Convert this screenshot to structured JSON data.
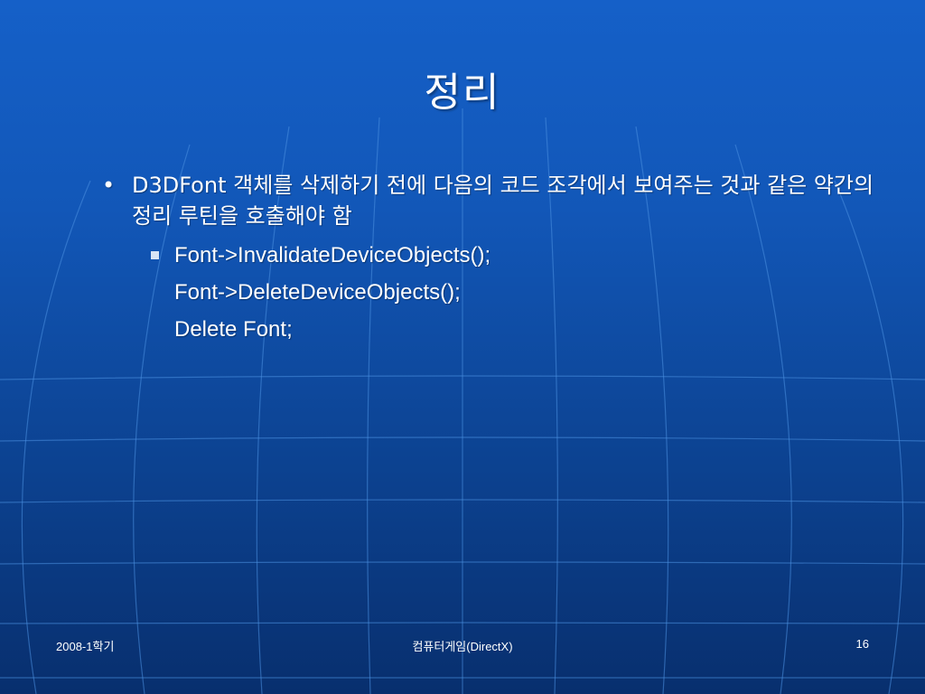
{
  "slide": {
    "title": "정리",
    "bullet": {
      "marker": "•",
      "text": "D3DFont 객체를 삭제하기 전에 다음의 코드 조각에서 보여주는 것과 같은 약간의 정리 루틴을 호출해야 함"
    },
    "code_lines": [
      "Font->InvalidateDeviceObjects();",
      "Font->DeleteDeviceObjects();",
      "Delete Font;"
    ]
  },
  "footer": {
    "left": "2008-1학기",
    "center": "컴퓨터게임(DirectX)",
    "page_number": "16"
  },
  "colors": {
    "background_top": "#1560c8",
    "background_bottom": "#082f6e",
    "grid_lines": "#4a8fe0",
    "text": "#ffffff"
  }
}
